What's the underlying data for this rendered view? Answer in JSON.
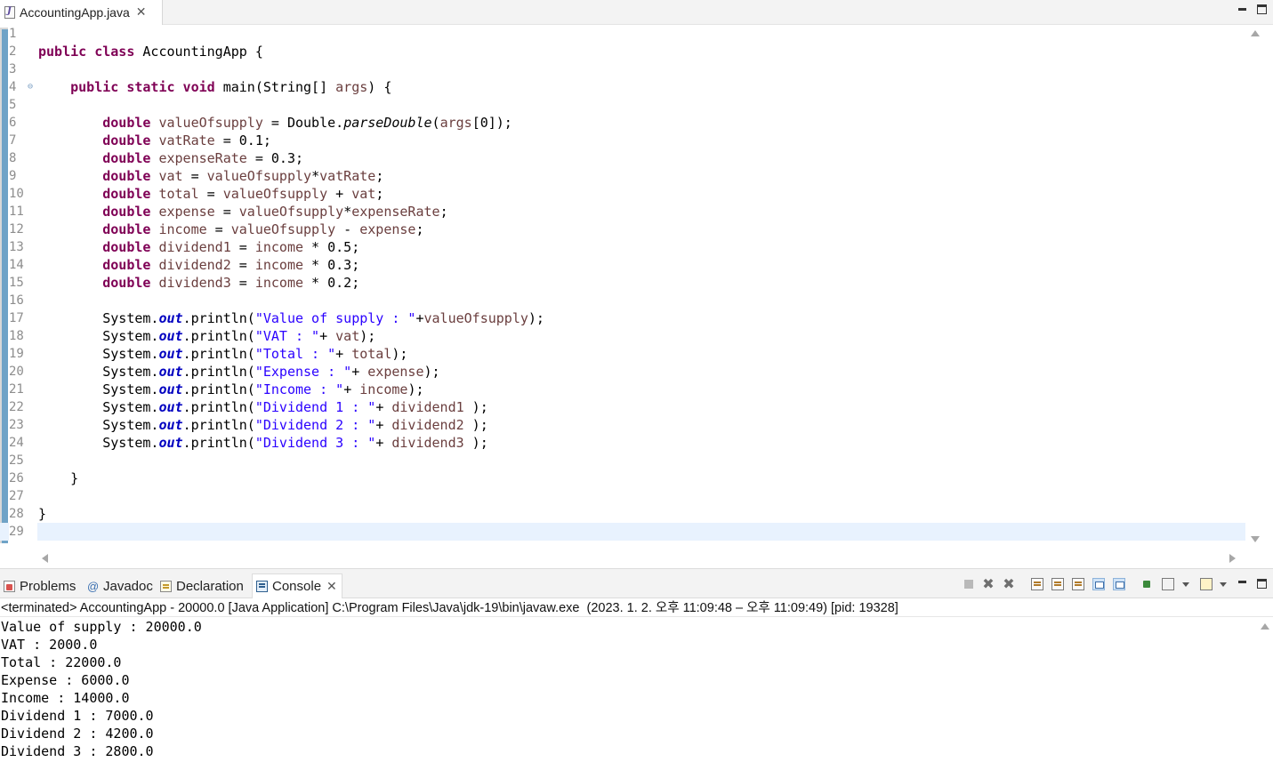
{
  "editor": {
    "tab_label": "AccountingApp.java",
    "line_numbers": [
      "1",
      "2",
      "3",
      "4",
      "5",
      "6",
      "7",
      "8",
      "9",
      "10",
      "11",
      "12",
      "13",
      "14",
      "15",
      "16",
      "17",
      "18",
      "19",
      "20",
      "21",
      "22",
      "23",
      "24",
      "25",
      "26",
      "27",
      "28",
      "29"
    ],
    "current_line": 29,
    "folding_line": 4
  },
  "code_lines": [
    [],
    [
      {
        "t": "public class ",
        "c": "kw"
      },
      {
        "t": "AccountingApp {",
        "c": ""
      }
    ],
    [],
    [
      {
        "t": "    ",
        "c": ""
      },
      {
        "t": "public static void ",
        "c": "kw"
      },
      {
        "t": "main(String[] ",
        "c": ""
      },
      {
        "t": "args",
        "c": "var"
      },
      {
        "t": ") {",
        "c": ""
      }
    ],
    [],
    [
      {
        "t": "        ",
        "c": ""
      },
      {
        "t": "double ",
        "c": "kw"
      },
      {
        "t": "valueOfsupply",
        "c": "var"
      },
      {
        "t": " = Double.",
        "c": ""
      },
      {
        "t": "parseDouble",
        "c": "mth"
      },
      {
        "t": "(",
        "c": ""
      },
      {
        "t": "args",
        "c": "var"
      },
      {
        "t": "[0]);",
        "c": ""
      }
    ],
    [
      {
        "t": "        ",
        "c": ""
      },
      {
        "t": "double ",
        "c": "kw"
      },
      {
        "t": "vatRate",
        "c": "var"
      },
      {
        "t": " = 0.1;",
        "c": ""
      }
    ],
    [
      {
        "t": "        ",
        "c": ""
      },
      {
        "t": "double ",
        "c": "kw"
      },
      {
        "t": "expenseRate",
        "c": "var"
      },
      {
        "t": " = 0.3;",
        "c": ""
      }
    ],
    [
      {
        "t": "        ",
        "c": ""
      },
      {
        "t": "double ",
        "c": "kw"
      },
      {
        "t": "vat",
        "c": "var"
      },
      {
        "t": " = ",
        "c": ""
      },
      {
        "t": "valueOfsupply",
        "c": "var"
      },
      {
        "t": "*",
        "c": ""
      },
      {
        "t": "vatRate",
        "c": "var"
      },
      {
        "t": ";",
        "c": ""
      }
    ],
    [
      {
        "t": "        ",
        "c": ""
      },
      {
        "t": "double ",
        "c": "kw"
      },
      {
        "t": "total",
        "c": "var"
      },
      {
        "t": " = ",
        "c": ""
      },
      {
        "t": "valueOfsupply",
        "c": "var"
      },
      {
        "t": " + ",
        "c": ""
      },
      {
        "t": "vat",
        "c": "var"
      },
      {
        "t": ";",
        "c": ""
      }
    ],
    [
      {
        "t": "        ",
        "c": ""
      },
      {
        "t": "double ",
        "c": "kw"
      },
      {
        "t": "expense",
        "c": "var"
      },
      {
        "t": " = ",
        "c": ""
      },
      {
        "t": "valueOfsupply",
        "c": "var"
      },
      {
        "t": "*",
        "c": ""
      },
      {
        "t": "expenseRate",
        "c": "var"
      },
      {
        "t": ";",
        "c": ""
      }
    ],
    [
      {
        "t": "        ",
        "c": ""
      },
      {
        "t": "double ",
        "c": "kw"
      },
      {
        "t": "income",
        "c": "var"
      },
      {
        "t": " = ",
        "c": ""
      },
      {
        "t": "valueOfsupply",
        "c": "var"
      },
      {
        "t": " - ",
        "c": ""
      },
      {
        "t": "expense",
        "c": "var"
      },
      {
        "t": ";",
        "c": ""
      }
    ],
    [
      {
        "t": "        ",
        "c": ""
      },
      {
        "t": "double ",
        "c": "kw"
      },
      {
        "t": "dividend1",
        "c": "var"
      },
      {
        "t": " = ",
        "c": ""
      },
      {
        "t": "income",
        "c": "var"
      },
      {
        "t": " * 0.5;",
        "c": ""
      }
    ],
    [
      {
        "t": "        ",
        "c": ""
      },
      {
        "t": "double ",
        "c": "kw"
      },
      {
        "t": "dividend2",
        "c": "var"
      },
      {
        "t": " = ",
        "c": ""
      },
      {
        "t": "income",
        "c": "var"
      },
      {
        "t": " * 0.3;",
        "c": ""
      }
    ],
    [
      {
        "t": "        ",
        "c": ""
      },
      {
        "t": "double ",
        "c": "kw"
      },
      {
        "t": "dividend3",
        "c": "var"
      },
      {
        "t": " = ",
        "c": ""
      },
      {
        "t": "income",
        "c": "var"
      },
      {
        "t": " * 0.2;",
        "c": ""
      }
    ],
    [],
    [
      {
        "t": "        System.",
        "c": ""
      },
      {
        "t": "out",
        "c": "fld"
      },
      {
        "t": ".println(",
        "c": ""
      },
      {
        "t": "\"Value of supply : \"",
        "c": "str"
      },
      {
        "t": "+",
        "c": ""
      },
      {
        "t": "valueOfsupply",
        "c": "var"
      },
      {
        "t": ");",
        "c": ""
      }
    ],
    [
      {
        "t": "        System.",
        "c": ""
      },
      {
        "t": "out",
        "c": "fld"
      },
      {
        "t": ".println(",
        "c": ""
      },
      {
        "t": "\"VAT : \"",
        "c": "str"
      },
      {
        "t": "+ ",
        "c": ""
      },
      {
        "t": "vat",
        "c": "var"
      },
      {
        "t": ");",
        "c": ""
      }
    ],
    [
      {
        "t": "        System.",
        "c": ""
      },
      {
        "t": "out",
        "c": "fld"
      },
      {
        "t": ".println(",
        "c": ""
      },
      {
        "t": "\"Total : \"",
        "c": "str"
      },
      {
        "t": "+ ",
        "c": ""
      },
      {
        "t": "total",
        "c": "var"
      },
      {
        "t": ");",
        "c": ""
      }
    ],
    [
      {
        "t": "        System.",
        "c": ""
      },
      {
        "t": "out",
        "c": "fld"
      },
      {
        "t": ".println(",
        "c": ""
      },
      {
        "t": "\"Expense : \"",
        "c": "str"
      },
      {
        "t": "+ ",
        "c": ""
      },
      {
        "t": "expense",
        "c": "var"
      },
      {
        "t": ");",
        "c": ""
      }
    ],
    [
      {
        "t": "        System.",
        "c": ""
      },
      {
        "t": "out",
        "c": "fld"
      },
      {
        "t": ".println(",
        "c": ""
      },
      {
        "t": "\"Income : \"",
        "c": "str"
      },
      {
        "t": "+ ",
        "c": ""
      },
      {
        "t": "income",
        "c": "var"
      },
      {
        "t": ");",
        "c": ""
      }
    ],
    [
      {
        "t": "        System.",
        "c": ""
      },
      {
        "t": "out",
        "c": "fld"
      },
      {
        "t": ".println(",
        "c": ""
      },
      {
        "t": "\"Dividend 1 : \"",
        "c": "str"
      },
      {
        "t": "+ ",
        "c": ""
      },
      {
        "t": "dividend1",
        "c": "var"
      },
      {
        "t": " );",
        "c": ""
      }
    ],
    [
      {
        "t": "        System.",
        "c": ""
      },
      {
        "t": "out",
        "c": "fld"
      },
      {
        "t": ".println(",
        "c": ""
      },
      {
        "t": "\"Dividend 2 : \"",
        "c": "str"
      },
      {
        "t": "+ ",
        "c": ""
      },
      {
        "t": "dividend2",
        "c": "var"
      },
      {
        "t": " );",
        "c": ""
      }
    ],
    [
      {
        "t": "        System.",
        "c": ""
      },
      {
        "t": "out",
        "c": "fld"
      },
      {
        "t": ".println(",
        "c": ""
      },
      {
        "t": "\"Dividend 3 : \"",
        "c": "str"
      },
      {
        "t": "+ ",
        "c": ""
      },
      {
        "t": "dividend3",
        "c": "var"
      },
      {
        "t": " );",
        "c": ""
      }
    ],
    [],
    [
      {
        "t": "    }",
        "c": ""
      }
    ],
    [],
    [
      {
        "t": "}",
        "c": ""
      }
    ],
    []
  ],
  "views": {
    "tabs": [
      {
        "label": "Problems",
        "icon": "problems-icon"
      },
      {
        "label": "Javadoc",
        "icon": "at-icon"
      },
      {
        "label": "Declaration",
        "icon": "declaration-icon"
      },
      {
        "label": "Console",
        "icon": "console-icon",
        "active": true
      }
    ]
  },
  "console": {
    "status": "<terminated> AccountingApp - 20000.0 [Java Application] C:\\Program Files\\Java\\jdk-19\\bin\\javaw.exe  (2023. 1. 2. 오후 11:09:48 – 오후 11:09:49) [pid: 19328]",
    "output": [
      "Value of supply : 20000.0",
      "VAT : 2000.0",
      "Total : 22000.0",
      "Expense : 6000.0",
      "Income : 14000.0",
      "Dividend 1 : 7000.0",
      "Dividend 2 : 4200.0",
      "Dividend 3 : 2800.0"
    ]
  },
  "colors": {
    "keyword": "#7f0055",
    "string": "#2a00ff",
    "variable": "#6a3e3e",
    "field": "#0000c0",
    "current_line_bg": "#e8f2fe"
  }
}
